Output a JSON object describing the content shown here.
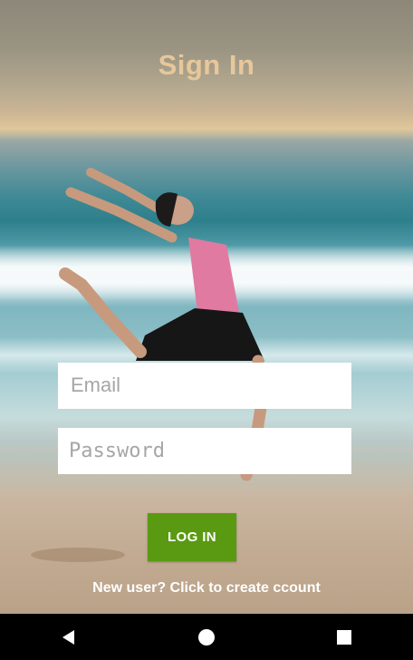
{
  "header": {
    "title": "Sign In"
  },
  "form": {
    "email_placeholder": "Email",
    "password_placeholder": "Password",
    "login_label": "LOG IN",
    "signup_link": "New user? Click to create ccount"
  },
  "navbar": {
    "back_icon": "back-icon",
    "home_icon": "home-icon",
    "recents_icon": "recents-icon"
  },
  "colors": {
    "title": "#e7c79b",
    "login_button": "#5a9a13",
    "navbar": "#000000"
  }
}
